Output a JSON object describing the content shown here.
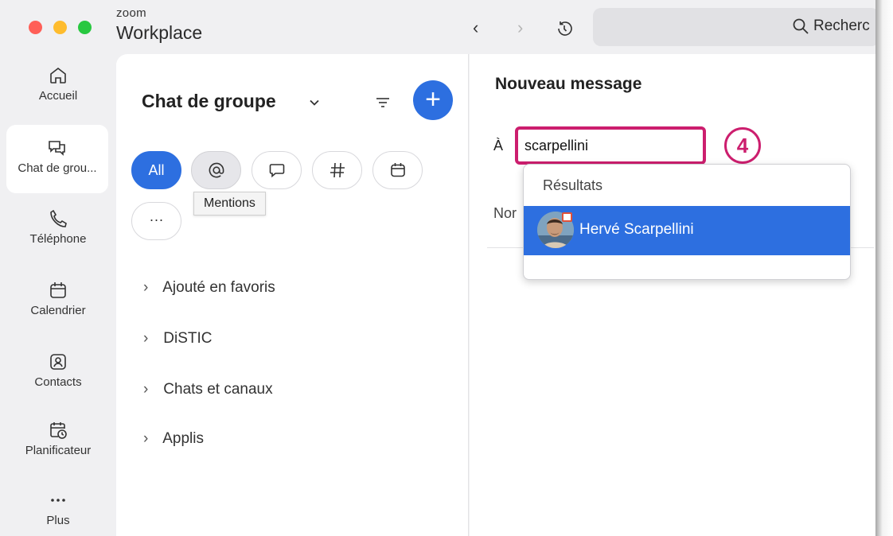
{
  "app": {
    "brand_small": "zoom",
    "brand_large": "Workplace"
  },
  "toolbar": {
    "back_label": "‹",
    "forward_label": "›",
    "search_label": "Recherc"
  },
  "sidebar": {
    "items": [
      {
        "label": "Accueil",
        "icon": "home-icon",
        "active": false
      },
      {
        "label": "Chat de grou...",
        "icon": "chat-icon",
        "active": true
      },
      {
        "label": "Téléphone",
        "icon": "phone-icon",
        "active": false
      },
      {
        "label": "Calendrier",
        "icon": "calendar-icon",
        "active": false
      },
      {
        "label": "Contacts",
        "icon": "contacts-icon",
        "active": false
      },
      {
        "label": "Planificateur",
        "icon": "scheduler-icon",
        "active": false
      },
      {
        "label": "Plus",
        "icon": "more-icon",
        "active": false
      }
    ]
  },
  "chat_panel": {
    "title": "Chat de groupe",
    "add_label": "+",
    "filters": {
      "all_label": "All",
      "more_label": "···",
      "tooltip": "Mentions"
    },
    "sections": [
      {
        "label": "Ajouté en favoris"
      },
      {
        "label": "DiSTIC"
      },
      {
        "label": "Chats et canaux"
      },
      {
        "label": "Applis"
      }
    ]
  },
  "compose": {
    "title": "Nouveau message",
    "to_label": "À",
    "to_value": "scarpellini",
    "name_label": "Nor",
    "step_badge": "4"
  },
  "results": {
    "header": "Résultats",
    "items": [
      {
        "name": "Hervé Scarpellini"
      }
    ]
  },
  "colors": {
    "accent": "#2d6fe0",
    "highlight": "#cc1e6e"
  }
}
